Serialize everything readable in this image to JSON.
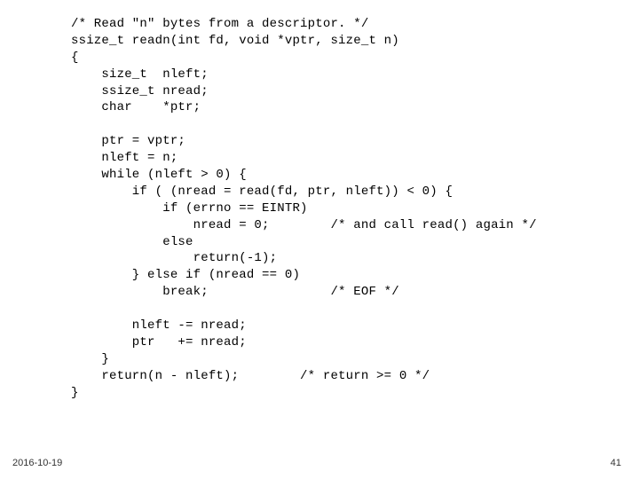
{
  "footer": {
    "date": "2016-10-19",
    "page": "41"
  },
  "code": {
    "lines": [
      "/* Read \"n\" bytes from a descriptor. */",
      "ssize_t readn(int fd, void *vptr, size_t n)",
      "{",
      "    size_t  nleft;",
      "    ssize_t nread;",
      "    char    *ptr;",
      "",
      "    ptr = vptr;",
      "    nleft = n;",
      "    while (nleft > 0) {",
      "        if ( (nread = read(fd, ptr, nleft)) < 0) {",
      "            if (errno == EINTR)",
      "                nread = 0;        /* and call read() again */",
      "            else",
      "                return(-1);",
      "        } else if (nread == 0)",
      "            break;                /* EOF */",
      "",
      "        nleft -= nread;",
      "        ptr   += nread;",
      "    }",
      "    return(n - nleft);        /* return >= 0 */",
      "}"
    ]
  }
}
